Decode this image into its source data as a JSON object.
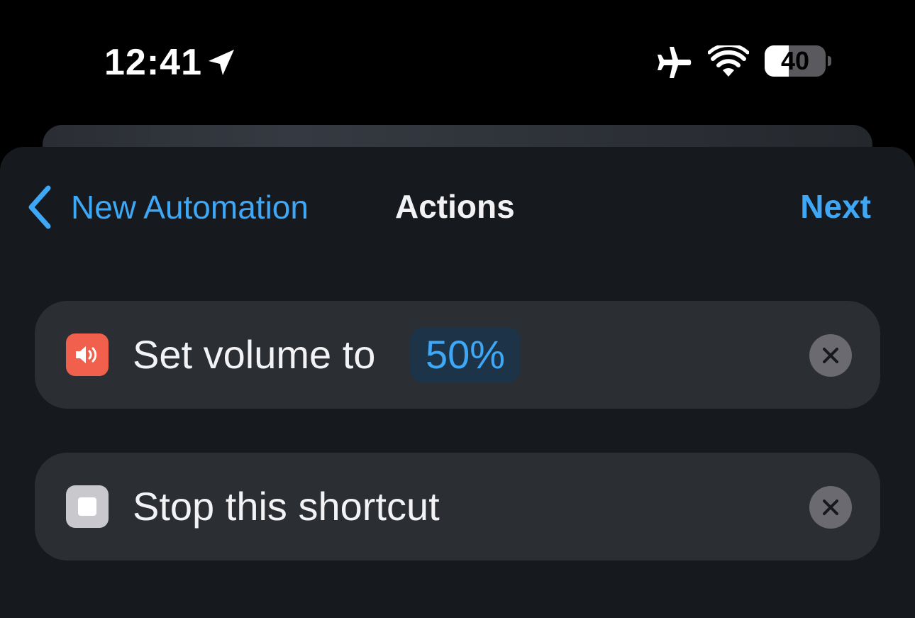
{
  "status_bar": {
    "time": "12:41",
    "location_icon": "location-arrow-icon",
    "airplane_icon": "airplane-icon",
    "wifi_icon": "wifi-icon",
    "battery_level": "40",
    "battery_fraction": 0.4
  },
  "nav": {
    "back_icon": "chevron-left-icon",
    "back_label": "New Automation",
    "title": "Actions",
    "next_label": "Next"
  },
  "actions": [
    {
      "icon": "speaker-volume-icon",
      "label": "Set volume to",
      "parameter": "50%",
      "remove_icon": "close-icon"
    },
    {
      "icon": "stop-square-icon",
      "label": "Stop this shortcut",
      "remove_icon": "close-icon"
    }
  ],
  "colors": {
    "accent": "#3ea7f6",
    "volume_icon_bg": "#f0604c",
    "card_bg": "#2b2e33",
    "sheet_bg": "#16191d"
  }
}
